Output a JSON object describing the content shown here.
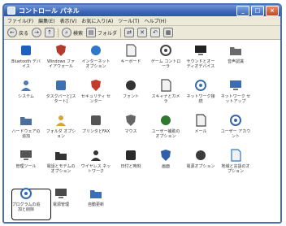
{
  "window": {
    "title": "コントロール パネル",
    "buttons": {
      "minimize": "_",
      "maximize": "□",
      "close": "×"
    }
  },
  "menubar": {
    "items": [
      "ファイル(F)",
      "編集(E)",
      "表示(V)",
      "お気に入り(A)",
      "ツール(T)",
      "ヘルプ(H)"
    ]
  },
  "toolbar": {
    "back": "←",
    "back_label": "戻る",
    "forward": "→",
    "up": "↑",
    "search": "検索",
    "folders": "フォルダ"
  },
  "icons": [
    {
      "name": "bluetooth",
      "label": "Bluetooth デバイス",
      "color": "#1f5fbf"
    },
    {
      "name": "windows-firewall",
      "label": "Windows ファイアウォール",
      "color": "#b33b2e"
    },
    {
      "name": "internet-options",
      "label": "インターネット オプション",
      "color": "#2d78c8"
    },
    {
      "name": "keyboard",
      "label": "キーボード",
      "color": "#555555"
    },
    {
      "name": "game-controllers",
      "label": "ゲーム コントローラ",
      "color": "#444444"
    },
    {
      "name": "sounds-audio",
      "label": "サウンドとオーディオデバイス",
      "color": "#222222"
    },
    {
      "name": "speech",
      "label": "音声認識",
      "color": "#6a6a6a"
    },
    {
      "name": "system",
      "label": "システム",
      "color": "#4a7ab8"
    },
    {
      "name": "taskbar-start",
      "label": "タスクバーと[スタート]",
      "color": "#3f6fb3"
    },
    {
      "name": "security-center",
      "label": "セキュリティ センター",
      "color": "#c43a2a"
    },
    {
      "name": "fonts",
      "label": "フォント",
      "color": "#333333"
    },
    {
      "name": "scanners-cameras",
      "label": "スキャナとカメラ",
      "color": "#4a4a4a"
    },
    {
      "name": "network-connections",
      "label": "ネットワーク接続",
      "color": "#3b6db0"
    },
    {
      "name": "network-setup",
      "label": "ネットワーク セットアップ",
      "color": "#3b6db0"
    },
    {
      "name": "add-hardware",
      "label": "ハードウェアの追加",
      "color": "#4b6f9e"
    },
    {
      "name": "folder-options",
      "label": "フォルダ オプション",
      "color": "#d6a531"
    },
    {
      "name": "printers-faxes",
      "label": "プリンタとFAX",
      "color": "#555555"
    },
    {
      "name": "mouse",
      "label": "マウス",
      "color": "#666666"
    },
    {
      "name": "accessibility",
      "label": "ユーザー補助のオプション",
      "color": "#2f7a2f"
    },
    {
      "name": "mail",
      "label": "メール",
      "color": "#444444"
    },
    {
      "name": "user-accounts",
      "label": "ユーザー アカウント",
      "color": "#3a64a8"
    },
    {
      "name": "admin-tools",
      "label": "管理ツール",
      "color": "#555555"
    },
    {
      "name": "phone-modem",
      "label": "電話とモデムのオプション",
      "color": "#333333"
    },
    {
      "name": "wireless",
      "label": "ワイヤレス ネットワーク",
      "color": "#333333"
    },
    {
      "name": "date-time",
      "label": "日付と時刻",
      "color": "#2a2a2a"
    },
    {
      "name": "display",
      "label": "画面",
      "color": "#2f5fa8"
    },
    {
      "name": "power-options",
      "label": "電源オプション",
      "color": "#3a3a3a"
    },
    {
      "name": "regional-language",
      "label": "地域と言語のオプション",
      "color": "#2d78c8"
    },
    {
      "name": "add-remove-programs",
      "label": "プログラムの追加と削除",
      "color": "#2d6cb3"
    },
    {
      "name": "power-management",
      "label": "電源管理",
      "color": "#4a4a4a"
    },
    {
      "name": "automatic-updates",
      "label": "自動更新",
      "color": "#3a6fb8"
    }
  ],
  "selected_icon": "add-remove-programs"
}
